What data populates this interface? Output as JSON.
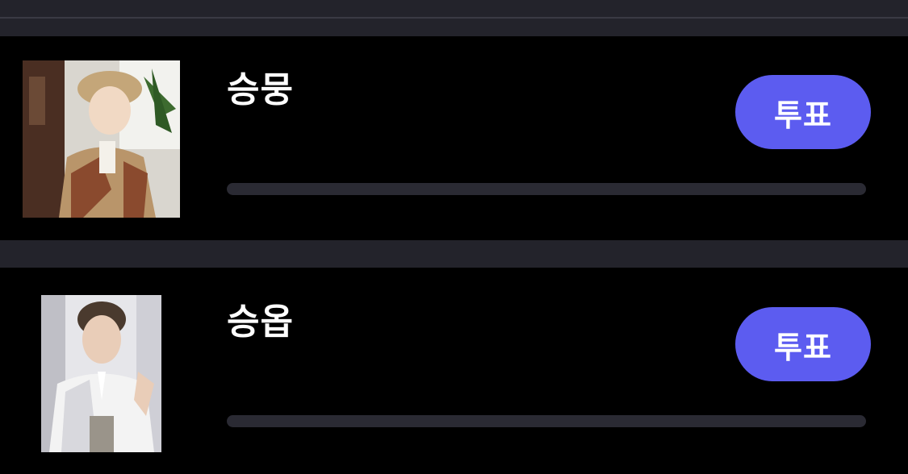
{
  "colors": {
    "accent": "#5c5cf0",
    "background": "#000000",
    "separator": "#23232b",
    "progress_track": "#2a2a33"
  },
  "candidates": [
    {
      "name": "승뭉",
      "vote_label": "투표",
      "progress": 0,
      "photo_icon": "profile-photo"
    },
    {
      "name": "승옵",
      "vote_label": "투표",
      "progress": 0,
      "photo_icon": "profile-photo"
    }
  ]
}
